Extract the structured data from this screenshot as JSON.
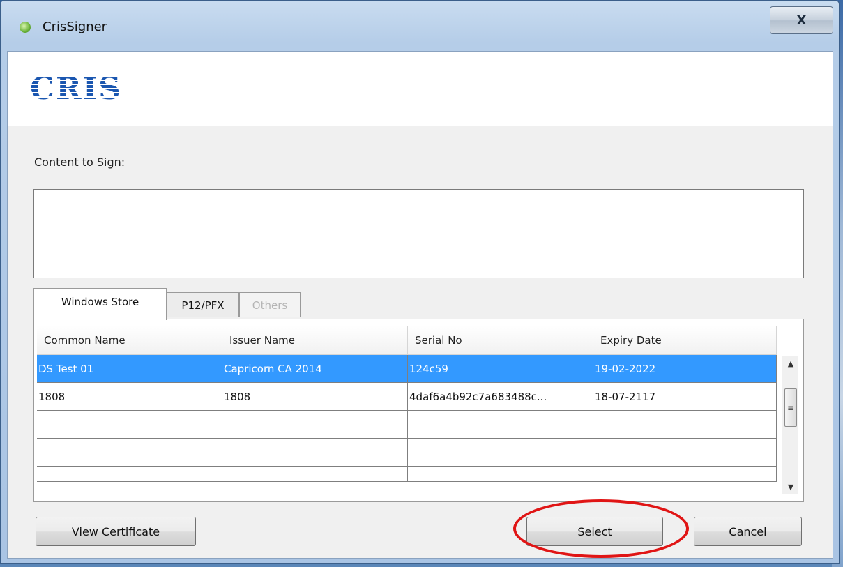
{
  "window": {
    "title": "CrisSigner",
    "close_label": "X"
  },
  "banner": {
    "logo_text": "CRIS"
  },
  "content": {
    "label": "Content to Sign:",
    "value": ""
  },
  "tabs": [
    {
      "label": "Windows Store",
      "state": "active"
    },
    {
      "label": "P12/PFX",
      "state": "normal"
    },
    {
      "label": "Others",
      "state": "disabled"
    }
  ],
  "table": {
    "columns": [
      "Common Name",
      "Issuer Name",
      "Serial No",
      "Expiry Date"
    ],
    "rows": [
      {
        "common_name": "DS Test 01",
        "issuer_name": "Capricorn CA 2014",
        "serial_no": "124c59",
        "expiry_date": "19-02-2022",
        "selected": true
      },
      {
        "common_name": "1808",
        "issuer_name": "1808",
        "serial_no": "4daf6a4b92c7a683488c...",
        "expiry_date": "18-07-2117",
        "selected": false
      }
    ]
  },
  "buttons": {
    "view_certificate": "View Certificate",
    "select": "Select",
    "cancel": "Cancel"
  },
  "colors": {
    "selection": "#3399ff",
    "annotation": "#e01515"
  }
}
